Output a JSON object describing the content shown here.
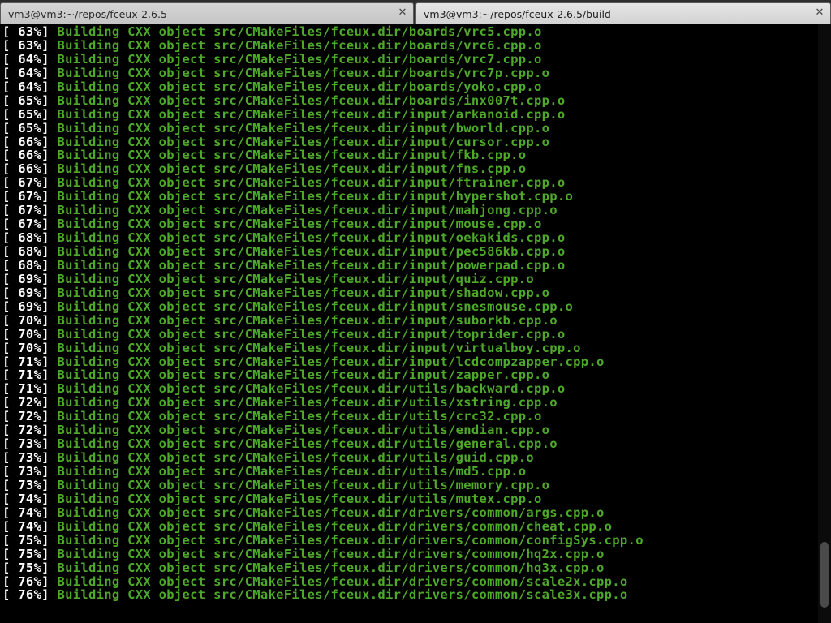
{
  "tabs": [
    {
      "title": "vm3@vm3:~/repos/fceux-2.6.5",
      "close_glyph": "✕",
      "active": false
    },
    {
      "title": "vm3@vm3:~/repos/fceux-2.6.5/build",
      "close_glyph": "✕",
      "active": true
    }
  ],
  "colors": {
    "terminal_bg": "#000000",
    "percent_text": "#ffffff",
    "build_text": "#4ea82a"
  },
  "scrollbar": {
    "position_fraction": 0.98,
    "visible_fraction": 0.11
  },
  "terminal": {
    "lines": [
      {
        "pct": "[ 63%]",
        "msg": "Building CXX object src/CMakeFiles/fceux.dir/boards/vrc5.cpp.o"
      },
      {
        "pct": "[ 63%]",
        "msg": "Building CXX object src/CMakeFiles/fceux.dir/boards/vrc6.cpp.o"
      },
      {
        "pct": "[ 64%]",
        "msg": "Building CXX object src/CMakeFiles/fceux.dir/boards/vrc7.cpp.o"
      },
      {
        "pct": "[ 64%]",
        "msg": "Building CXX object src/CMakeFiles/fceux.dir/boards/vrc7p.cpp.o"
      },
      {
        "pct": "[ 64%]",
        "msg": "Building CXX object src/CMakeFiles/fceux.dir/boards/yoko.cpp.o"
      },
      {
        "pct": "[ 65%]",
        "msg": "Building CXX object src/CMakeFiles/fceux.dir/boards/inx007t.cpp.o"
      },
      {
        "pct": "[ 65%]",
        "msg": "Building CXX object src/CMakeFiles/fceux.dir/input/arkanoid.cpp.o"
      },
      {
        "pct": "[ 65%]",
        "msg": "Building CXX object src/CMakeFiles/fceux.dir/input/bworld.cpp.o"
      },
      {
        "pct": "[ 66%]",
        "msg": "Building CXX object src/CMakeFiles/fceux.dir/input/cursor.cpp.o"
      },
      {
        "pct": "[ 66%]",
        "msg": "Building CXX object src/CMakeFiles/fceux.dir/input/fkb.cpp.o"
      },
      {
        "pct": "[ 66%]",
        "msg": "Building CXX object src/CMakeFiles/fceux.dir/input/fns.cpp.o"
      },
      {
        "pct": "[ 67%]",
        "msg": "Building CXX object src/CMakeFiles/fceux.dir/input/ftrainer.cpp.o"
      },
      {
        "pct": "[ 67%]",
        "msg": "Building CXX object src/CMakeFiles/fceux.dir/input/hypershot.cpp.o"
      },
      {
        "pct": "[ 67%]",
        "msg": "Building CXX object src/CMakeFiles/fceux.dir/input/mahjong.cpp.o"
      },
      {
        "pct": "[ 67%]",
        "msg": "Building CXX object src/CMakeFiles/fceux.dir/input/mouse.cpp.o"
      },
      {
        "pct": "[ 68%]",
        "msg": "Building CXX object src/CMakeFiles/fceux.dir/input/oekakids.cpp.o"
      },
      {
        "pct": "[ 68%]",
        "msg": "Building CXX object src/CMakeFiles/fceux.dir/input/pec586kb.cpp.o"
      },
      {
        "pct": "[ 68%]",
        "msg": "Building CXX object src/CMakeFiles/fceux.dir/input/powerpad.cpp.o"
      },
      {
        "pct": "[ 69%]",
        "msg": "Building CXX object src/CMakeFiles/fceux.dir/input/quiz.cpp.o"
      },
      {
        "pct": "[ 69%]",
        "msg": "Building CXX object src/CMakeFiles/fceux.dir/input/shadow.cpp.o"
      },
      {
        "pct": "[ 69%]",
        "msg": "Building CXX object src/CMakeFiles/fceux.dir/input/snesmouse.cpp.o"
      },
      {
        "pct": "[ 70%]",
        "msg": "Building CXX object src/CMakeFiles/fceux.dir/input/suborkb.cpp.o"
      },
      {
        "pct": "[ 70%]",
        "msg": "Building CXX object src/CMakeFiles/fceux.dir/input/toprider.cpp.o"
      },
      {
        "pct": "[ 70%]",
        "msg": "Building CXX object src/CMakeFiles/fceux.dir/input/virtualboy.cpp.o"
      },
      {
        "pct": "[ 71%]",
        "msg": "Building CXX object src/CMakeFiles/fceux.dir/input/lcdcompzapper.cpp.o"
      },
      {
        "pct": "[ 71%]",
        "msg": "Building CXX object src/CMakeFiles/fceux.dir/input/zapper.cpp.o"
      },
      {
        "pct": "[ 71%]",
        "msg": "Building CXX object src/CMakeFiles/fceux.dir/utils/backward.cpp.o"
      },
      {
        "pct": "[ 72%]",
        "msg": "Building CXX object src/CMakeFiles/fceux.dir/utils/xstring.cpp.o"
      },
      {
        "pct": "[ 72%]",
        "msg": "Building CXX object src/CMakeFiles/fceux.dir/utils/crc32.cpp.o"
      },
      {
        "pct": "[ 72%]",
        "msg": "Building CXX object src/CMakeFiles/fceux.dir/utils/endian.cpp.o"
      },
      {
        "pct": "[ 73%]",
        "msg": "Building CXX object src/CMakeFiles/fceux.dir/utils/general.cpp.o"
      },
      {
        "pct": "[ 73%]",
        "msg": "Building CXX object src/CMakeFiles/fceux.dir/utils/guid.cpp.o"
      },
      {
        "pct": "[ 73%]",
        "msg": "Building CXX object src/CMakeFiles/fceux.dir/utils/md5.cpp.o"
      },
      {
        "pct": "[ 73%]",
        "msg": "Building CXX object src/CMakeFiles/fceux.dir/utils/memory.cpp.o"
      },
      {
        "pct": "[ 74%]",
        "msg": "Building CXX object src/CMakeFiles/fceux.dir/utils/mutex.cpp.o"
      },
      {
        "pct": "[ 74%]",
        "msg": "Building CXX object src/CMakeFiles/fceux.dir/drivers/common/args.cpp.o"
      },
      {
        "pct": "[ 74%]",
        "msg": "Building CXX object src/CMakeFiles/fceux.dir/drivers/common/cheat.cpp.o"
      },
      {
        "pct": "[ 75%]",
        "msg": "Building CXX object src/CMakeFiles/fceux.dir/drivers/common/configSys.cpp.o"
      },
      {
        "pct": "[ 75%]",
        "msg": "Building CXX object src/CMakeFiles/fceux.dir/drivers/common/hq2x.cpp.o"
      },
      {
        "pct": "[ 75%]",
        "msg": "Building CXX object src/CMakeFiles/fceux.dir/drivers/common/hq3x.cpp.o"
      },
      {
        "pct": "[ 76%]",
        "msg": "Building CXX object src/CMakeFiles/fceux.dir/drivers/common/scale2x.cpp.o"
      },
      {
        "pct": "[ 76%]",
        "msg": "Building CXX object src/CMakeFiles/fceux.dir/drivers/common/scale3x.cpp.o"
      }
    ]
  }
}
